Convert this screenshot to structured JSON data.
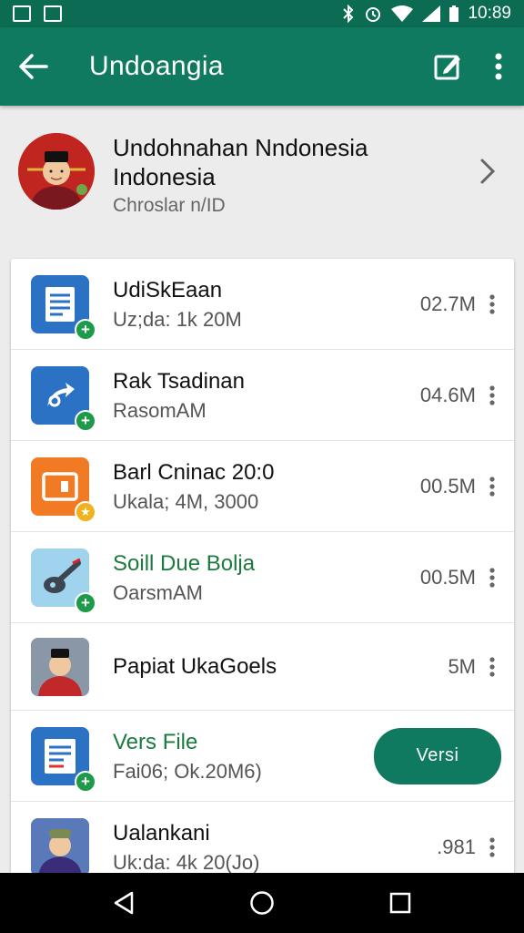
{
  "status_bar": {
    "time": "10:89"
  },
  "app_bar": {
    "title": "Undoangia",
    "back_icon": "arrow-left-icon",
    "edit_icon": "edit-icon",
    "menu_icon": "more-vertical-icon"
  },
  "profile": {
    "name_line1": "Undohnahan Nndonesia",
    "name_line2": "Indonesia",
    "subtitle": "Chroslar n/ID"
  },
  "items": [
    {
      "title": "UdiSkEaan",
      "subtitle": "Uz;da: 1k 20M",
      "size": "02.7M",
      "icon": "document-icon",
      "icon_color": "#2b72c4",
      "badge": "plus"
    },
    {
      "title": "Rak Tsadinan",
      "subtitle": "RasomAM",
      "size": "04.6M",
      "icon": "share-icon",
      "icon_color": "#2b72c4",
      "badge": "plus"
    },
    {
      "title": "Barl Cninac 20:0",
      "subtitle": "Ukala; 4M, 3000",
      "size": "00.5M",
      "icon": "video-icon",
      "icon_color": "#f07b24",
      "badge": "star"
    },
    {
      "title": "Soill Due Bolja",
      "subtitle": "OarsmAM",
      "size": "00.5M",
      "icon": "tool-icon",
      "icon_color": "#9fd3ee",
      "badge": "plus"
    },
    {
      "title": "Papiat UkaGoels",
      "subtitle": "",
      "size": "5M",
      "icon": "person-icon",
      "icon_color": "#6d7c8e",
      "badge": ""
    },
    {
      "title": "Vers File",
      "subtitle": "Fai06; Ok.20M6)",
      "button_label": "Versi",
      "icon": "document-icon",
      "icon_color": "#2b72c4",
      "badge": "plus"
    },
    {
      "title": "Ualankani",
      "subtitle": "Uk:da: 4k 20(Jo)",
      "size": ".981",
      "icon": "person-icon",
      "icon_color": "#3d5fa8",
      "badge": ""
    }
  ],
  "colors": {
    "primary": "#0f7a60",
    "status_bar": "#0b6b53",
    "accent_green": "#1e9a4a",
    "blue_icon": "#2b72c4",
    "orange_icon": "#f07b24"
  },
  "nav": {
    "back_icon": "nav-back-icon",
    "home_icon": "nav-home-icon",
    "recents_icon": "nav-recents-icon"
  }
}
